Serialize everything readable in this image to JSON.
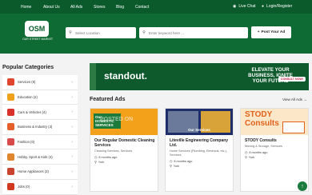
{
  "nav": {
    "links": [
      "Home",
      "About Us",
      "All Ads",
      "Stores",
      "Blog",
      "Contact"
    ],
    "live_chat": "Live Chat",
    "login": "Login/Register"
  },
  "logo": {
    "text": "OSM",
    "tagline": "OUR STREET MARKET"
  },
  "search": {
    "location_placeholder": "Select Location",
    "keyword_placeholder": "Enter keyword here ...",
    "post_button": "Post Your Ad"
  },
  "sidebar": {
    "title": "Popular Categories",
    "categories": [
      {
        "label": "Services (8)",
        "color": "#e0462f"
      },
      {
        "label": "Education (2)",
        "color": "#f0a21b"
      },
      {
        "label": "Cars & Vehicles (4)",
        "color": "#d9312b"
      },
      {
        "label": "Business & Industry (3)",
        "color": "#e65e2a"
      },
      {
        "label": "Fashion (0)",
        "color": "#d94a4a"
      },
      {
        "label": "Hobby, Sport & Kids (4)",
        "color": "#e0862f"
      },
      {
        "label": "Home Appliances (3)",
        "color": "#c9432f"
      },
      {
        "label": "Jobs (0)",
        "color": "#d0391f"
      }
    ]
  },
  "banner": {
    "brand": "standout.",
    "headline": "ELEVATE YOUR BUSINESS, IGNITE YOUR FUTURE",
    "cta": "CONSULT NOW!"
  },
  "featured": {
    "title": "Featured Ads",
    "view_all": "View All Ads",
    "cards": [
      {
        "title": "Our Regular Domestic Cleaning Services",
        "category": "Cleaning Services, Services",
        "posted": "8 months ago",
        "location": "York",
        "img_text": "Our DOMESTIC SERVICES"
      },
      {
        "title": "Liteville Engineering Company Ltd.",
        "category": "Home Services (Plumbing, Electrical, etc.), Services",
        "posted": "8 months ago",
        "location": "York",
        "img_text": "Our Services"
      },
      {
        "title": "STODY Consults",
        "category": "Moving & Storage, Services",
        "posted": "8 months ago",
        "location": "York",
        "img_text": "STODY Consults"
      }
    ]
  },
  "watermark": "POSTED ON"
}
